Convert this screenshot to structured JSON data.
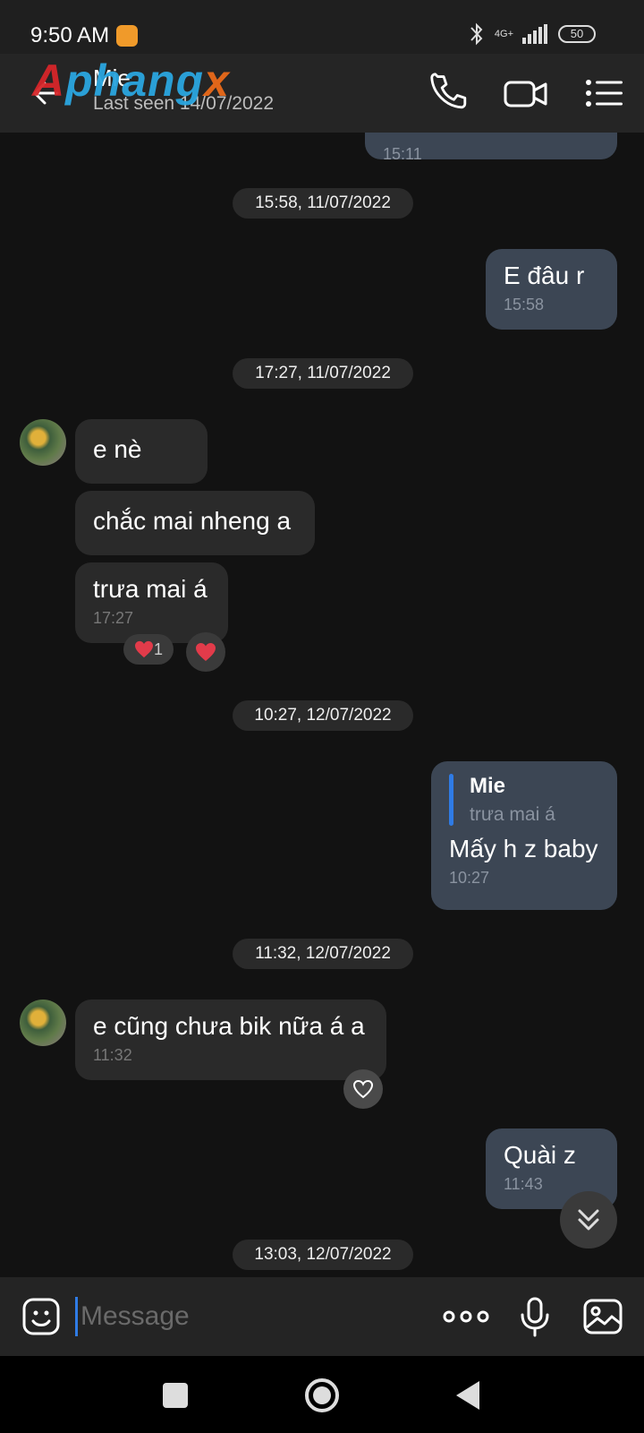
{
  "status_bar": {
    "time": "9:50 AM",
    "network": "4G+",
    "battery": "50"
  },
  "header": {
    "watermark": {
      "part1": "A",
      "part2": "phang",
      "part3": "x"
    },
    "contact_name": "Mie",
    "last_seen": "Last seen 14/07/2022",
    "icons": [
      "back-arrow-icon",
      "phone-icon",
      "video-camera-icon",
      "menu-list-icon"
    ]
  },
  "messages": {
    "m0": {
      "time": "15:11"
    },
    "d1": "15:58, 11/07/2022",
    "m1": {
      "text": "E đâu r",
      "time": "15:58"
    },
    "d2": "17:27, 11/07/2022",
    "m2": {
      "text": "e nè"
    },
    "m3": {
      "text": "chắc mai nheng a"
    },
    "m4": {
      "text": "trưa mai á",
      "time": "17:27",
      "reaction_count": "1"
    },
    "d3": "10:27, 12/07/2022",
    "m5": {
      "reply_name": "Mie",
      "reply_text": "trưa mai á",
      "text": "Mấy h z baby",
      "time": "10:27"
    },
    "d4": "11:32, 12/07/2022",
    "m6": {
      "text": "e cũng chưa bik nữa á a",
      "time": "11:32"
    },
    "m7": {
      "text": "Quài z",
      "time": "11:43"
    },
    "d5": "13:03, 12/07/2022"
  },
  "input": {
    "placeholder": "Message"
  },
  "colors": {
    "accent": "#2f7be5",
    "bubble_out": "#3c4654",
    "bubble_in": "#2a2a2a",
    "heart": "#e23b4a"
  }
}
